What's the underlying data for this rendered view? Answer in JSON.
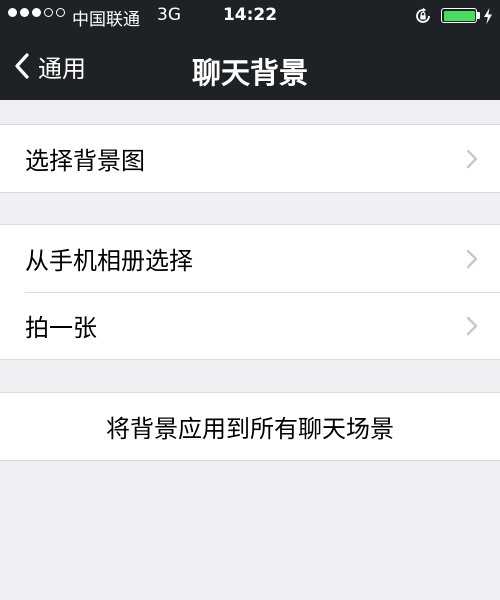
{
  "status_bar": {
    "signal_dots_full": 3,
    "signal_dots_total": 5,
    "carrier": "中国联通",
    "network": "3G",
    "time": "14:22",
    "battery_level": 1.0,
    "battery_color": "#4cd964",
    "icons": [
      "rotation-lock-icon",
      "battery-icon",
      "charging-icon"
    ]
  },
  "nav": {
    "back_label": "通用",
    "title": "聊天背景",
    "background_color": "#1f2224"
  },
  "groups": [
    {
      "items": [
        {
          "label": "选择背景图",
          "has_chevron": true
        }
      ]
    },
    {
      "items": [
        {
          "label": "从手机相册选择",
          "has_chevron": true
        },
        {
          "label": "拍一张",
          "has_chevron": true
        }
      ]
    },
    {
      "items": [
        {
          "label": "将背景应用到所有聊天场景",
          "has_chevron": false
        }
      ]
    }
  ],
  "colors": {
    "page_background": "#efeff4",
    "chevron": "#c7c7cc"
  }
}
